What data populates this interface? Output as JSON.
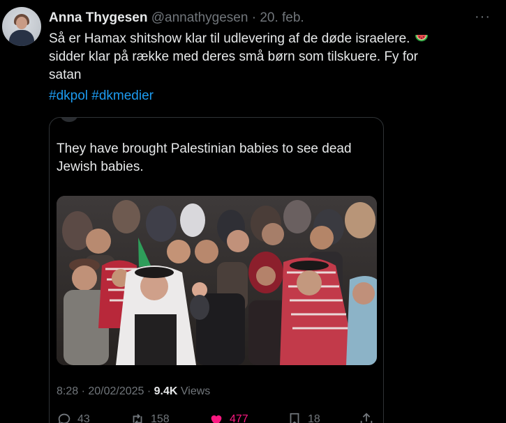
{
  "author": {
    "name": "Anna Thygesen",
    "handle": "@annathygesen",
    "separator": " · ",
    "date": "20. feb."
  },
  "more_label": "···",
  "tweet_text": {
    "line1": "Så er Hamax shitshow klar til udlevering af de døde israelere. ",
    "line2": "sidder klar på række med deres små børn som tilskuere. Fy for",
    "line3": "satan"
  },
  "hashtags": [
    "#dkpol",
    "#dkmedier"
  ],
  "quote": {
    "text": "They have brought Palestinian babies to see dead Jewish babies.",
    "time": "8:28",
    "date": "20/02/2025",
    "meta_separator": " · ",
    "views_count": "9.4K",
    "views_label": " Views"
  },
  "actions": {
    "replies": "43",
    "reposts": "158",
    "likes": "477",
    "bookmarks": "18"
  },
  "colors": {
    "background": "#000000",
    "text": "#e7e9ea",
    "muted": "#71767b",
    "link": "#1d9bf0",
    "like": "#f91880",
    "border": "#2f3336"
  },
  "icons": [
    "more-icon",
    "watermelon-emoji-icon",
    "reply-icon",
    "repost-icon",
    "like-heart-icon",
    "bookmark-icon",
    "share-icon"
  ]
}
